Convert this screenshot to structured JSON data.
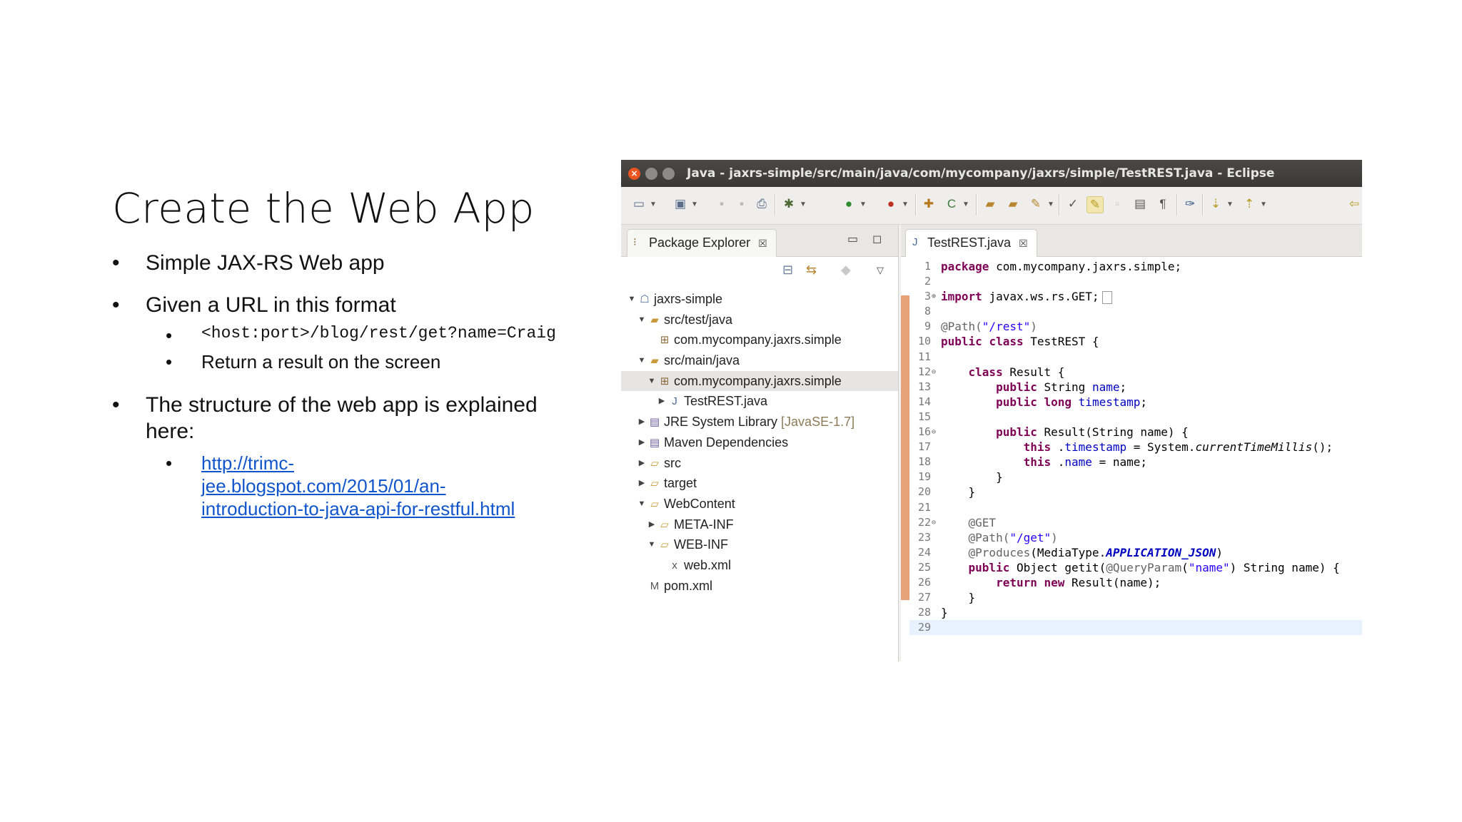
{
  "slide": {
    "title": "Create the Web App",
    "bullets": [
      {
        "text": "Simple JAX-RS Web app"
      },
      {
        "text": "Given a URL in this format",
        "sub": [
          {
            "text": "<host:port>/blog/rest/get?name=Craig",
            "mono": true
          },
          {
            "text": "Return a result on the screen"
          }
        ]
      },
      {
        "text": "The structure of the web app is explained here:",
        "sub": [
          {
            "link": [
              "http://trimc-",
              "jee.blogspot.com/2015/01/an-",
              "introduction-to-java-api-for-restful.html"
            ]
          }
        ]
      }
    ],
    "bullet_glyph": "•"
  },
  "eclipse": {
    "window_title": "Java - jaxrs-simple/src/main/java/com/mycompany/jaxrs/simple/TestREST.java - Eclipse",
    "close_glyph": "×",
    "package_explorer": {
      "tab_label": "Package Explorer",
      "tab_close": "☒",
      "tree": [
        {
          "label": "jaxrs-simple",
          "level": 0,
          "arrow": "▼",
          "icon": "project-icon"
        },
        {
          "label": "src/test/java",
          "level": 1,
          "arrow": "▼",
          "icon": "source-folder-icon"
        },
        {
          "label": "com.mycompany.jaxrs.simple",
          "level": 2,
          "arrow": "",
          "icon": "package-icon"
        },
        {
          "label": "src/main/java",
          "level": 1,
          "arrow": "▼",
          "icon": "source-folder-icon"
        },
        {
          "label": "com.mycompany.jaxrs.simple",
          "level": 2,
          "arrow": "▼",
          "icon": "package-icon",
          "selected": true
        },
        {
          "label": "TestREST.java",
          "level": 3,
          "arrow": "▶",
          "icon": "java-file-icon"
        },
        {
          "label": "JRE System Library",
          "decoration": "[JavaSE-1.7]",
          "level": 1,
          "arrow": "▶",
          "icon": "library-icon"
        },
        {
          "label": "Maven Dependencies",
          "level": 1,
          "arrow": "▶",
          "icon": "library-icon"
        },
        {
          "label": "src",
          "level": 1,
          "arrow": "▶",
          "icon": "folder-icon"
        },
        {
          "label": "target",
          "level": 1,
          "arrow": "▶",
          "icon": "folder-icon"
        },
        {
          "label": "WebContent",
          "level": 1,
          "arrow": "▼",
          "icon": "folder-icon"
        },
        {
          "label": "META-INF",
          "level": 2,
          "arrow": "▶",
          "icon": "folder-icon"
        },
        {
          "label": "WEB-INF",
          "level": 2,
          "arrow": "▼",
          "icon": "folder-icon"
        },
        {
          "label": "web.xml",
          "level": 3,
          "arrow": "",
          "icon": "xml-file-icon"
        },
        {
          "label": "pom.xml",
          "level": 1,
          "arrow": "",
          "icon": "pom-file-icon"
        }
      ]
    },
    "editor": {
      "tab_label": "TestREST.java",
      "tab_close": "☒",
      "lines": [
        {
          "n": "1",
          "fold": "",
          "tokens": [
            [
              "kw",
              "package"
            ],
            [
              "",
              "com.mycompany.jaxrs.simple;"
            ]
          ]
        },
        {
          "n": "2",
          "fold": "",
          "tokens": []
        },
        {
          "n": "3",
          "fold": "⊕",
          "tokens": [
            [
              "kw",
              "import"
            ],
            [
              "",
              "javax.ws.rs.GET;"
            ]
          ],
          "collapsed": true
        },
        {
          "n": "8",
          "fold": "",
          "tokens": []
        },
        {
          "n": "9",
          "fold": "",
          "tokens": [
            [
              "ann",
              "@Path("
            ],
            [
              "str",
              "\"/rest\""
            ],
            [
              "ann",
              ")"
            ]
          ]
        },
        {
          "n": "10",
          "fold": "",
          "tokens": [
            [
              "kw",
              "public"
            ],
            [
              "kw",
              "class"
            ],
            [
              "",
              "TestREST {"
            ]
          ]
        },
        {
          "n": "11",
          "fold": "",
          "tokens": []
        },
        {
          "n": "12",
          "fold": "⊖",
          "tokens": [
            [
              "",
              "    "
            ],
            [
              "kw",
              "class"
            ],
            [
              "",
              "Result {"
            ]
          ]
        },
        {
          "n": "13",
          "fold": "",
          "tokens": [
            [
              "",
              "        "
            ],
            [
              "kw",
              "public"
            ],
            [
              "",
              "String "
            ],
            [
              "fld",
              "name"
            ],
            [
              "",
              ";"
            ]
          ]
        },
        {
          "n": "14",
          "fold": "",
          "tokens": [
            [
              "",
              "        "
            ],
            [
              "kw",
              "public"
            ],
            [
              "kw",
              "long"
            ],
            [
              "fld",
              "timestamp"
            ],
            [
              "",
              ";"
            ]
          ]
        },
        {
          "n": "15",
          "fold": "",
          "tokens": []
        },
        {
          "n": "16",
          "fold": "⊖",
          "tokens": [
            [
              "",
              "        "
            ],
            [
              "kw",
              "public"
            ],
            [
              "",
              "Result(String name) {"
            ]
          ]
        },
        {
          "n": "17",
          "fold": "",
          "tokens": [
            [
              "",
              "            "
            ],
            [
              "kw",
              "this"
            ],
            [
              "",
              "."
            ],
            [
              "fld",
              "timestamp"
            ],
            [
              "",
              " = System."
            ],
            [
              "ital",
              "currentTimeMillis"
            ],
            [
              "",
              "();"
            ]
          ]
        },
        {
          "n": "18",
          "fold": "",
          "tokens": [
            [
              "",
              "            "
            ],
            [
              "kw",
              "this"
            ],
            [
              "",
              "."
            ],
            [
              "fld",
              "name"
            ],
            [
              "",
              " = name;"
            ]
          ]
        },
        {
          "n": "19",
          "fold": "",
          "tokens": [
            [
              "",
              "        }"
            ]
          ]
        },
        {
          "n": "20",
          "fold": "",
          "tokens": [
            [
              "",
              "    }"
            ]
          ]
        },
        {
          "n": "21",
          "fold": "",
          "tokens": []
        },
        {
          "n": "22",
          "fold": "⊖",
          "tokens": [
            [
              "",
              "    "
            ],
            [
              "ann",
              "@GET"
            ]
          ]
        },
        {
          "n": "23",
          "fold": "",
          "tokens": [
            [
              "",
              "    "
            ],
            [
              "ann",
              "@Path("
            ],
            [
              "str",
              "\"/get\""
            ],
            [
              "ann",
              ")"
            ]
          ]
        },
        {
          "n": "24",
          "fold": "",
          "tokens": [
            [
              "",
              "    "
            ],
            [
              "ann",
              "@Produces"
            ],
            [
              "",
              "(MediaType."
            ],
            [
              "sfld",
              "APPLICATION_JSON"
            ],
            [
              "",
              ")"
            ]
          ]
        },
        {
          "n": "25",
          "fold": "",
          "tokens": [
            [
              "",
              "    "
            ],
            [
              "kw",
              "public"
            ],
            [
              "",
              "Object getit("
            ],
            [
              "ann",
              "@QueryParam"
            ],
            [
              "",
              "("
            ],
            [
              "str",
              "\"name\""
            ],
            [
              "",
              ") String name) {"
            ]
          ]
        },
        {
          "n": "26",
          "fold": "",
          "tokens": [
            [
              "",
              "        "
            ],
            [
              "kw",
              "return"
            ],
            [
              "kw",
              "new"
            ],
            [
              "",
              "Result(name);"
            ]
          ]
        },
        {
          "n": "27",
          "fold": "",
          "tokens": [
            [
              "",
              "    }"
            ]
          ]
        },
        {
          "n": "28",
          "fold": "",
          "tokens": [
            [
              "",
              "}"
            ]
          ]
        },
        {
          "n": "29",
          "fold": "",
          "tokens": [],
          "current": true
        }
      ]
    }
  }
}
